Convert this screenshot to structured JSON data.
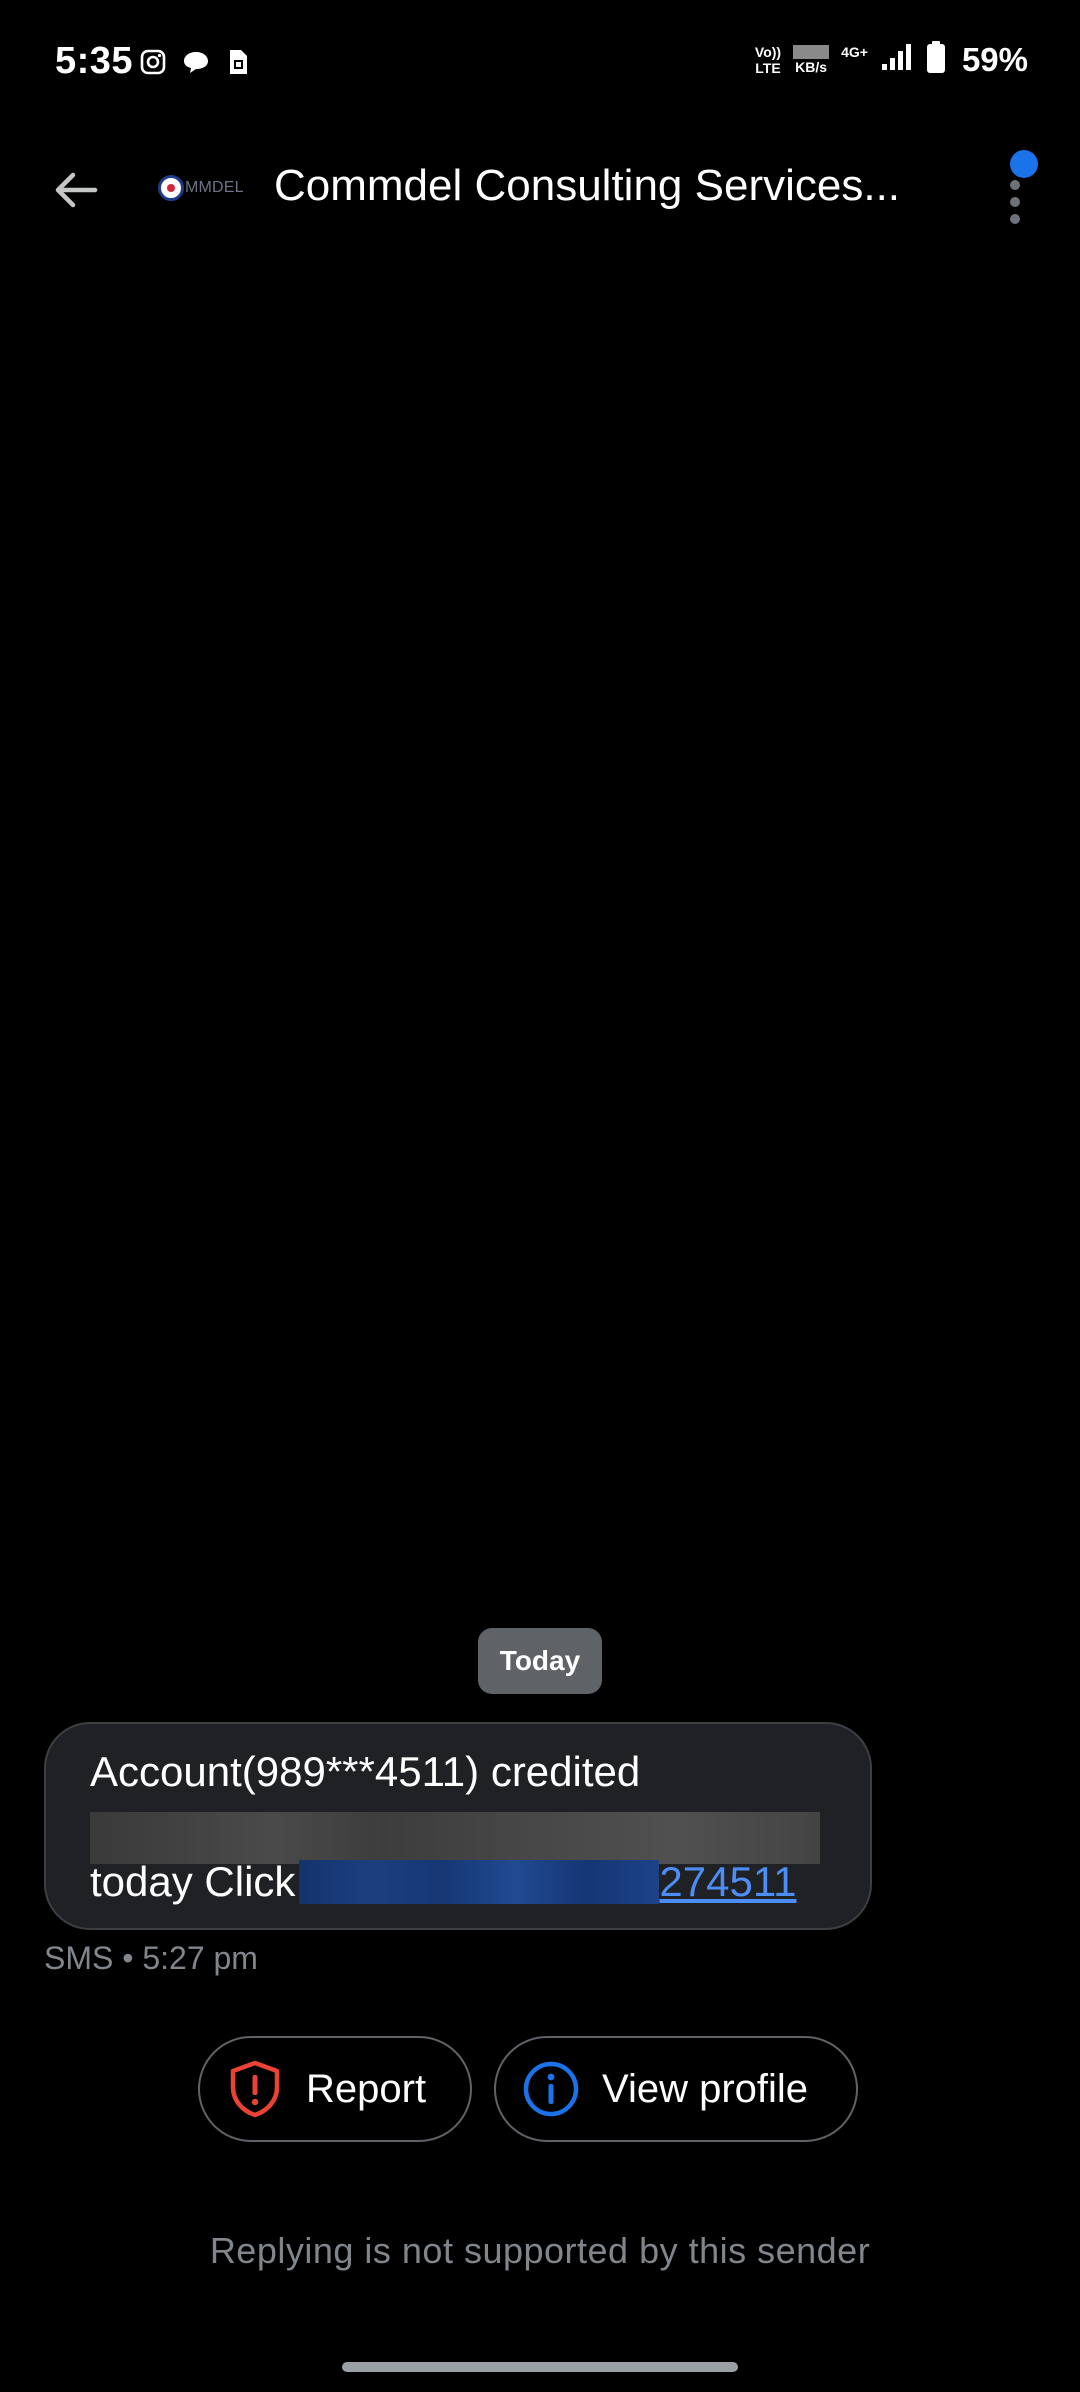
{
  "status_bar": {
    "time": "5:35",
    "volte_top": "Vo))",
    "volte_bottom": "LTE",
    "speed_unit": "KB/s",
    "network": "4G+",
    "battery": "59%",
    "left_icons": [
      "instagram-icon",
      "chat-bubble-icon",
      "sim-card-icon"
    ]
  },
  "app_bar": {
    "title": "Commdel Consulting Services...",
    "logo_text": "MMDEL",
    "back_icon": "arrow-back-icon",
    "more_icon": "more-vert-icon"
  },
  "conversation": {
    "date_chip": "Today",
    "message": {
      "line1": "Account(989***4511) credited",
      "line3_prefix": "today Click ",
      "link_visible_tail": "274511",
      "meta": "SMS • 5:27 pm"
    }
  },
  "actions": {
    "report_label": "Report",
    "view_profile_label": "View profile"
  },
  "footer": {
    "reply_notice": "Replying is not supported by this sender"
  },
  "colors": {
    "background": "#000000",
    "bubble": "#1f2124",
    "link": "#4c8df6",
    "accent_blue": "#1a73e8",
    "report_red": "#ea4335",
    "muted_text": "#80868b"
  }
}
